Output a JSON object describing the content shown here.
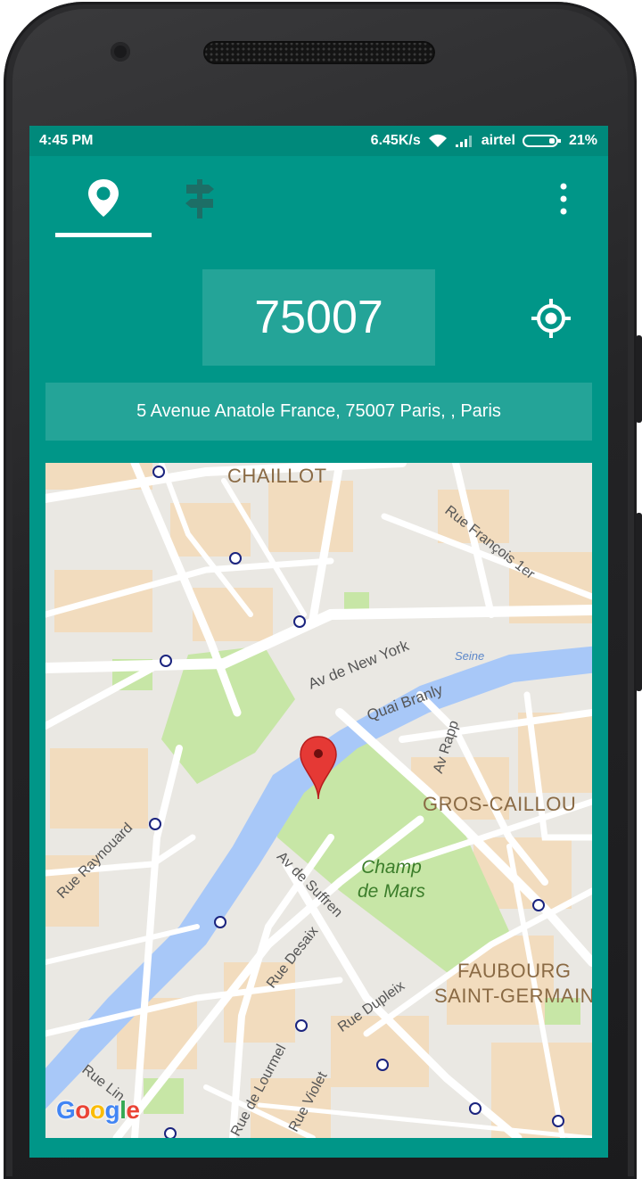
{
  "status_bar": {
    "time": "4:45 PM",
    "speed": "6.45K/s",
    "carrier": "airtel",
    "battery": "21%"
  },
  "tabs": [
    {
      "icon": "location-pin-icon",
      "selected": true
    },
    {
      "icon": "signpost-icon",
      "selected": false
    }
  ],
  "zip_code": "75007",
  "address": "5 Avenue Anatole France, 75007 Paris, , Paris",
  "map": {
    "labels": {
      "chaillot": "CHAILLOT",
      "rue_francois": "Rue François 1er",
      "av_new_york": "Av de New York",
      "seine": "Seine",
      "quai_branly": "Quai Branly",
      "av_rapp": "Av Rapp",
      "gros_caillou": "GROS-CAILLOU",
      "rue_raynouard": "Rue Raynouard",
      "champ_line1": "Champ",
      "champ_line2": "de Mars",
      "av_suffren": "Av de Suffren",
      "rue_desaix": "Rue Desaix",
      "rue_dupleix": "Rue Dupleix",
      "faubourg_line1": "FAUBOURG",
      "faubourg_line2": "SAINT-GERMAIN",
      "rue_lourmel": "Rue de Lourmel",
      "rue_violet": "Rue Violet",
      "rue_lin": "Rue Lin"
    },
    "attribution": "Google"
  },
  "colors": {
    "primary": "#009688",
    "primary_dark": "#00897b",
    "river": "#a8c8f8",
    "park": "#c7e6a6",
    "marker": "#e53935"
  }
}
